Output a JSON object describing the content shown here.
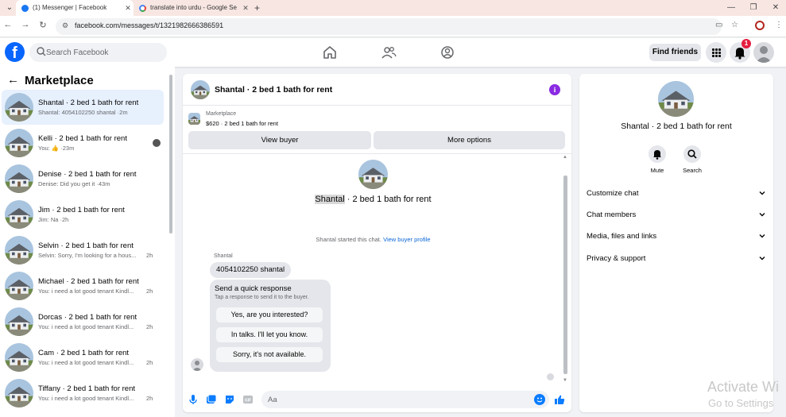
{
  "browser": {
    "tabs": [
      {
        "title": "(1) Messenger | Facebook",
        "active": true
      },
      {
        "title": "translate into urdu - Google Se",
        "active": false
      }
    ],
    "url": "facebook.com/messages/t/1321982666386591"
  },
  "header": {
    "search_placeholder": "Search Facebook",
    "find_friends_label": "Find friends",
    "notification_count": "1"
  },
  "left_panel": {
    "title": "Marketplace",
    "conversations": [
      {
        "name": "Shantal · 2 bed 1 bath for rent",
        "preview": "Shantal: 4054102250 shantal ·2m",
        "time": ""
      },
      {
        "name": "Kelli · 2 bed 1 bath for rent",
        "preview": "You: 👍 ·23m",
        "time": ""
      },
      {
        "name": "Denise · 2 bed 1 bath for rent",
        "preview": "Denise: Did you get it ·43m",
        "time": ""
      },
      {
        "name": "Jim · 2 bed 1 bath for rent",
        "preview": "Jim: Na ·2h",
        "time": ""
      },
      {
        "name": "Selvin · 2 bed 1 bath for rent",
        "preview": "Selvin: Sorry, I'm looking for a hous...",
        "time": "2h"
      },
      {
        "name": "Michael · 2 bed 1 bath for rent",
        "preview": "You: i need a lot good tenant Kindl...",
        "time": "2h"
      },
      {
        "name": "Dorcas · 2 bed 1 bath for rent",
        "preview": "You: i need a lot good tenant Kindl...",
        "time": "2h"
      },
      {
        "name": "Cam · 2 bed 1 bath for rent",
        "preview": "You: i need a lot good tenant Kindl...",
        "time": "2h"
      },
      {
        "name": "Tiffany · 2 bed 1 bath for rent",
        "preview": "You: i need a lot good tenant Kindl...",
        "time": "2h"
      }
    ]
  },
  "chat": {
    "title": "Shantal · 2 bed 1 bath for rent",
    "listing_category": "Marketplace",
    "listing_price": "$620 · 2 bed 1 bath for rent",
    "view_buyer_label": "View buyer",
    "more_options_label": "More options",
    "intro_name": "Shantal",
    "intro_rest": " · 2 bed 1 bath for rent",
    "started_text": "Shantal started this chat.",
    "view_profile_link": "View buyer profile",
    "sender_name": "Shantal",
    "message_text": "4054102250 shantal",
    "quick_title": "Send a quick response",
    "quick_subtitle": "Tap a response to send it to the buyer.",
    "quick_replies": [
      "Yes, are you interested?",
      "In talks. I'll let you know.",
      "Sorry, it's not available."
    ],
    "composer_placeholder": "Aa"
  },
  "right_panel": {
    "title": "Shantal · 2 bed 1 bath for rent",
    "mute_label": "Mute",
    "search_label": "Search",
    "sections": [
      "Customize chat",
      "Chat members",
      "Media, files and links",
      "Privacy & support"
    ]
  },
  "watermark": {
    "line1": "Activate Wi",
    "line2": "Go to Settings"
  },
  "colors": {
    "facebook_blue": "#0866ff",
    "selected_row": "#e7f0fd",
    "badge_red": "#e41e3f",
    "info_purple": "#8a2be2"
  }
}
